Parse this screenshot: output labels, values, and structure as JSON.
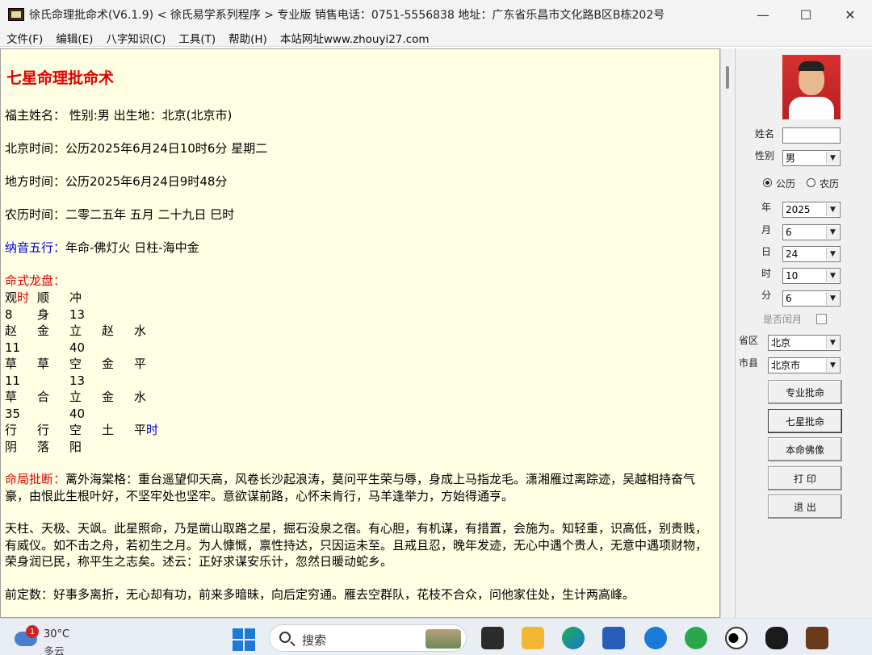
{
  "window": {
    "title": "徐氏命理批命术(V6.1.9) < 徐氏易学系列程序 > 专业版  销售电话：0751-5556838  地址：广东省乐昌市文化路B区B栋202号",
    "min_glyph": "—",
    "max_glyph": "☐",
    "close_glyph": "✕"
  },
  "menu": {
    "items": [
      "文件(F)",
      "编辑(E)",
      "八字知识(C)",
      "工具(T)",
      "帮助(H)",
      "本站网址www.zhouyi27.com"
    ]
  },
  "content": {
    "heading": "七星命理批命术",
    "name_line": "福主姓名：  性别:男   出生地：北京(北京市)",
    "beijing_time": "北京时间：公历2025年6月24日10时6分  星期二",
    "local_time": "地方时间：公历2025年6月24日9时48分",
    "lunar_time": "农历时间：二零二五年  五月  二十九日  巳时",
    "nayin_label": "纳音五行：",
    "nayin_value": "年命-佛灯火  日柱-海中金",
    "dragon_label": "命式龙盘：",
    "grid": [
      {
        "c1": "观",
        "c1r": "时",
        "c2": "顺",
        "c3": "冲",
        "c4": "",
        "c5": "",
        "c5b": ""
      },
      {
        "c1": " 8",
        "c1r": "",
        "c2": "身",
        "c3": "13",
        "c4": "",
        "c5": "",
        "c5b": ""
      },
      {
        "c1": "赵",
        "c1r": "",
        "c2": "金",
        "c3": "立",
        "c4": "赵",
        "c5": "水",
        "c5b": ""
      },
      {
        "c1": "11",
        "c1r": "",
        "c2": "",
        "c3": "40",
        "c4": "",
        "c5": "",
        "c5b": ""
      },
      {
        "c1": "草",
        "c1r": "",
        "c2": "草",
        "c3": "空",
        "c4": "金",
        "c5": "平",
        "c5b": ""
      },
      {
        "c1": "11",
        "c1r": "",
        "c2": "",
        "c3": "13",
        "c4": "",
        "c5": "",
        "c5b": ""
      },
      {
        "c1": "草",
        "c1r": "",
        "c2": "合",
        "c3": "立",
        "c4": "金",
        "c5": "水",
        "c5b": ""
      },
      {
        "c1": "35",
        "c1r": "",
        "c2": "",
        "c3": "40",
        "c4": "",
        "c5": "",
        "c5b": ""
      },
      {
        "c1": "行",
        "c1r": "",
        "c2": "行",
        "c3": "空",
        "c4": "土",
        "c5": "平",
        "c5b": "时"
      },
      {
        "c1": "阴",
        "c1r": "",
        "c2": "落",
        "c3": "阳",
        "c4": "",
        "c5": "",
        "c5b": ""
      }
    ],
    "judgment_label": "命局批断：",
    "judgment_text": "蓠外海棠格：重台遥望仰天高，风卷长沙起浪涛，莫问平生荣与辱，身成上马指龙毛。潇湘雁过离踪迹，吴越相持奋气豪，由恨此生根叶好，不坚牢处也坚牢。意欲谋前路，心怀未肯行，马羊逢举力，方始得通亨。",
    "para2": "天柱、天极、天飒。此星照命，乃是凿山取路之星，掘石没泉之宿。有心胆，有机谋，有措置，会施为。知轻重，识高低，别贵贱，有威仪。如不击之舟，若初生之月。为人慷慨，禀性持达，只因运未至。且戒且忍，晚年发迹，无心中遇个贵人，无意中遇项财物，荣身润已民，称平生之志矣。述云：正好求谋安乐计，忽然日暖动蛇乡。",
    "para3": "前定数：好事多离折，无心却有功，前来多暗昧，向后定穷通。雁去空群队，花枝不合众，问他家住处，生计两高峰。"
  },
  "panel": {
    "name_label": "姓名",
    "name_value": "",
    "gender_label": "性别",
    "gender_value": "男",
    "calendar_solar": "公历",
    "calendar_lunar": "农历",
    "year_label": "年",
    "year_value": "2025",
    "month_label": "月",
    "month_value": "6",
    "day_label": "日",
    "day_value": "24",
    "hour_label": "时",
    "hour_value": "10",
    "minute_label": "分",
    "minute_value": "6",
    "leap_label": "是否闰月",
    "province_label": "省区",
    "province_value": "北京",
    "city_label": "市县",
    "city_value": "北京市",
    "buttons": [
      "专业批命",
      "七星批命",
      "本命佛像",
      "打  印",
      "退  出"
    ]
  },
  "taskbar": {
    "badge": "1",
    "temperature": "30°C",
    "condition": "多云",
    "search_placeholder": "搜索"
  },
  "colors": {
    "content_bg": "#ffffe3",
    "accent_red": "#e00000",
    "accent_blue": "#0000e0"
  }
}
